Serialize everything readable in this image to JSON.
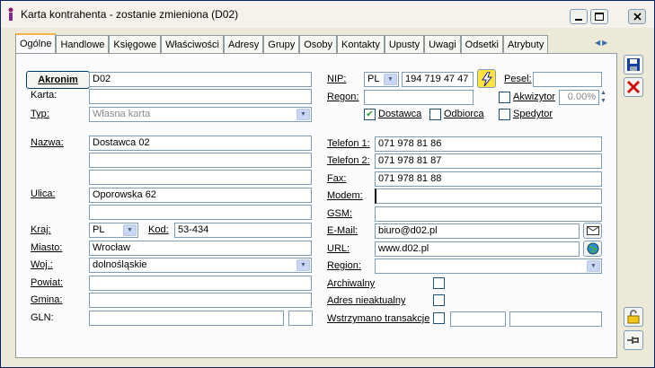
{
  "window": {
    "title": "Karta kontrahenta - zostanie zmieniona (D02)"
  },
  "tabs": [
    "Ogólne",
    "Handlowe",
    "Księgowe",
    "Właściwości",
    "Adresy",
    "Grupy",
    "Osoby",
    "Kontakty",
    "Upusty",
    "Uwagi",
    "Odsetki",
    "Atrybuty"
  ],
  "left": {
    "akronim_btn": "Akronim",
    "akronim": "D02",
    "karta_lbl": "Karta:",
    "karta": "",
    "typ_lbl": "Typ:",
    "typ": "Własna karta",
    "nazwa_lbl": "Nazwa:",
    "nazwa1": "Dostawca 02",
    "nazwa2": "",
    "nazwa3": "",
    "ulica_lbl": "Ulica:",
    "ulica1": "Oporowska 62",
    "ulica2": "",
    "kraj_lbl": "Kraj:",
    "kraj": "PL",
    "kod_lbl": "Kod:",
    "kod": "53-434",
    "miasto_lbl": "Miasto:",
    "miasto": "Wrocław",
    "woj_lbl": "Woj.:",
    "woj": "dolnośląskie",
    "powiat_lbl": "Powiat:",
    "powiat": "",
    "gmina_lbl": "Gmina:",
    "gmina": "",
    "gln_lbl": "GLN:",
    "gln": "",
    "gln2": ""
  },
  "right": {
    "nip_lbl": "NIP:",
    "nip_country": "PL",
    "nip": "194 719 47 47",
    "pesel_lbl": "Pesel:",
    "pesel": "",
    "regon_lbl": "Regon:",
    "regon": "",
    "akwizytor_lbl": "Akwizytor",
    "akwizytor_pct": "0.00%",
    "dostawca_lbl": "Dostawca",
    "odbiorca_lbl": "Odbiorca",
    "spedytor_lbl": "Spedytor",
    "tel1_lbl": "Telefon 1:",
    "tel1": "071 978 81 86",
    "tel2_lbl": "Telefon 2:",
    "tel2": "071 978 81 87",
    "fax_lbl": "Fax:",
    "fax": "071 978 81 88",
    "modem_lbl": "Modem:",
    "modem": "",
    "gsm_lbl": "GSM:",
    "gsm": "",
    "email_lbl": "E-Mail:",
    "email": "biuro@d02.pl",
    "url_lbl": "URL:",
    "url": "www.d02.pl",
    "region_lbl": "Region:",
    "region": "",
    "archiwalny_lbl": "Archiwalny",
    "adres_lbl": "Adres nieaktualny",
    "wstrzymano_lbl": "Wstrzymano transakcje"
  },
  "colors": {
    "accent": "#f9b34b",
    "border": "#7f9db9"
  }
}
